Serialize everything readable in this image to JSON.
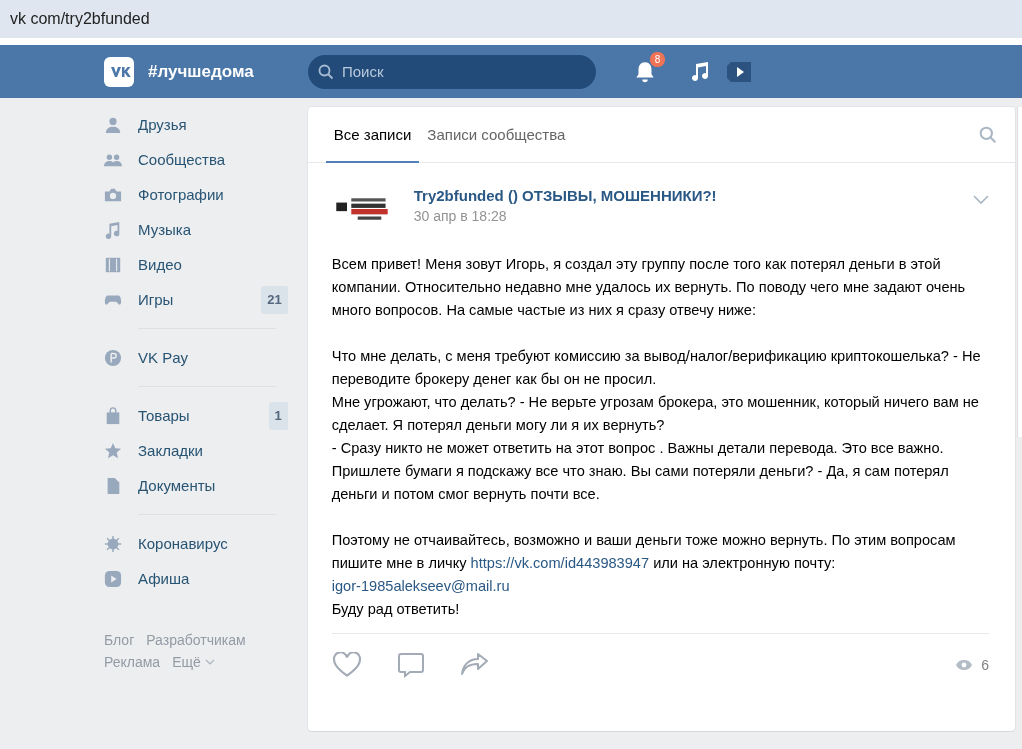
{
  "address_bar": {
    "url": "vk com/try2bfunded"
  },
  "header": {
    "slogan": "#лучшедома",
    "search": {
      "placeholder": "Поиск"
    },
    "notifications_badge": "8"
  },
  "sidebar": {
    "groups": [
      {
        "items": [
          {
            "label": "Друзья"
          },
          {
            "label": "Сообщества"
          },
          {
            "label": "Фотографии"
          },
          {
            "label": "Музыка"
          },
          {
            "label": "Видео"
          },
          {
            "label": "Игры",
            "count": "21"
          }
        ]
      },
      {
        "items": [
          {
            "label": "VK Pay"
          }
        ]
      },
      {
        "items": [
          {
            "label": "Товары",
            "count": "1"
          },
          {
            "label": "Закладки"
          },
          {
            "label": "Документы"
          }
        ]
      },
      {
        "items": [
          {
            "label": "Коронавирус"
          },
          {
            "label": "Афиша"
          }
        ]
      }
    ],
    "footer_links": [
      "Блог",
      "Разработчикам",
      "Реклама",
      "Ещё"
    ]
  },
  "tabs": [
    {
      "label": "Все записи",
      "selected": true
    },
    {
      "label": "Записи сообщества",
      "selected": false
    }
  ],
  "post": {
    "author": "Try2bfunded () ОТЗЫВЫ, МОШЕННИКИ?!",
    "date": "30 апр в 18:28",
    "paragraphs": [
      [
        [
          {
            "kind": "text",
            "text": "Всем привет! Меня зовут Игорь, я создал эту группу после того как потерял деньги в этой компании. Относительно недавно мне удалось их вернуть. По поводу чего мне задают очень много вопросов. На самые частые из них я сразу отвечу ниже:"
          }
        ]
      ],
      [
        [
          {
            "kind": "text",
            "text": "Что мне делать, с меня требуют комиссию за вывод/налог/верификацию криптокошелька? - Не переводите брокеру денег как бы он не просил."
          }
        ],
        [
          {
            "kind": "text",
            "text": "Мне угрожают, что делать? - Не верьте угрозам брокера, это мошенник, который ничего вам не сделает. Я потерял деньги могу ли я их вернуть?"
          }
        ],
        [
          {
            "kind": "text",
            "text": "- Сразу никто не может ответить на этот вопрос . Важны детали перевода. Это все важно. Пришлете бумаги я подскажу все что знаю. Вы сами потеряли деньги? - Да, я сам потерял деньги и потом смог вернуть почти все."
          }
        ]
      ],
      [
        [
          {
            "kind": "text",
            "text": "Поэтому не отчаивайтесь, возможно и ваши деньги тоже можно вернуть. По этим вопросам пишите мне в личку "
          },
          {
            "kind": "link",
            "text": "https://vk.com/id443983947"
          },
          {
            "kind": "text",
            "text": " или на электронную почту:"
          }
        ],
        [
          {
            "kind": "link",
            "text": "igor-1985alekseev@mail.ru"
          }
        ],
        [
          {
            "kind": "text",
            "text": "Буду рад ответить!"
          }
        ]
      ]
    ],
    "views": "6"
  }
}
